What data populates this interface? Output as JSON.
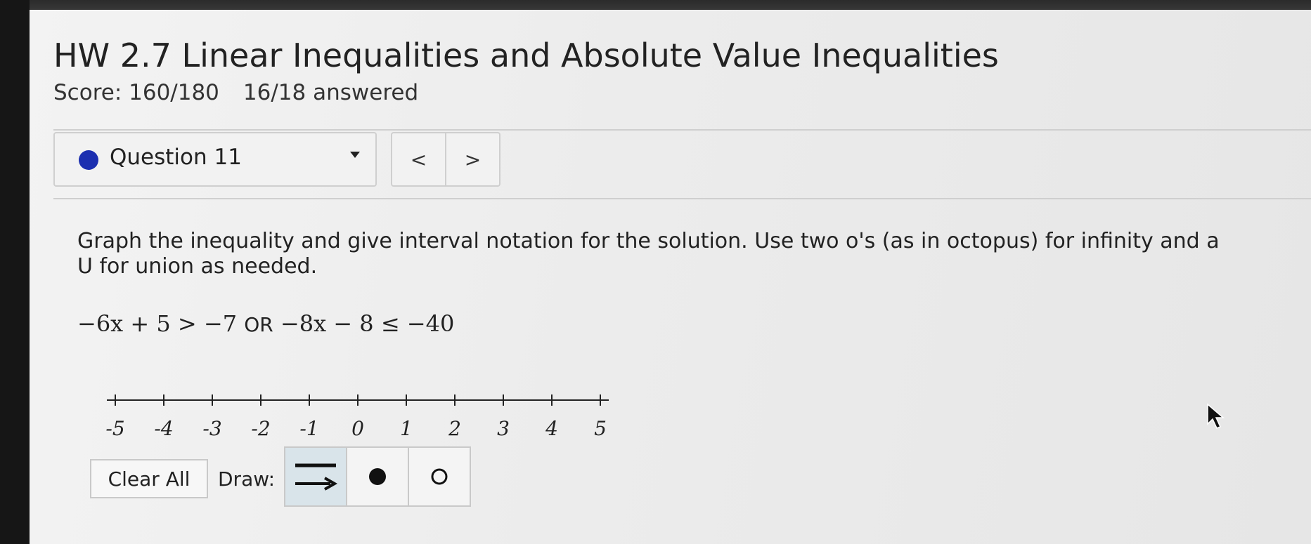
{
  "assignment": {
    "title": "HW 2.7 Linear Inequalities and Absolute Value Inequalities",
    "score": "Score: 160/180",
    "answered": "16/18 answered"
  },
  "question_nav": {
    "selected_question": "Question 11",
    "prev_label": "<",
    "next_label": ">",
    "status_color": "#1c2fb0"
  },
  "problem": {
    "prompt": "Graph the inequality and give interval notation for the solution. Use two o's (as in octopus) for infinity and a U for union as needed.",
    "inequality_left": "−6x + 5 > −7",
    "connector": "OR",
    "inequality_right": "−8x − 8 ≤ −40"
  },
  "number_line": {
    "ticks": [
      "-5",
      "-4",
      "-3",
      "-2",
      "-1",
      "0",
      "1",
      "2",
      "3",
      "4",
      "5"
    ]
  },
  "draw_tools": {
    "clear_label": "Clear All",
    "draw_label": "Draw:",
    "tools": [
      {
        "icon": "ray-arrow-icon",
        "selected": true
      },
      {
        "icon": "closed-dot-icon",
        "selected": false
      },
      {
        "icon": "open-dot-icon",
        "selected": false
      }
    ]
  }
}
